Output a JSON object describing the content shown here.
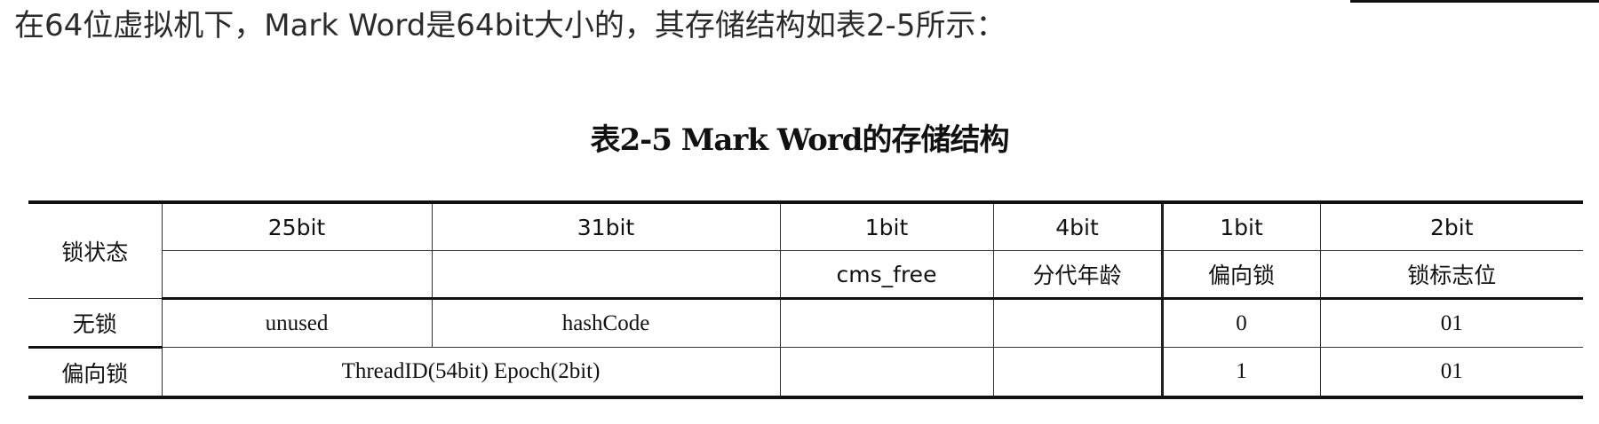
{
  "intro_text": "在64位虚拟机下，Mark Word是64bit大小的，其存储结构如表2-5所示：",
  "table_caption": "表2-5   Mark Word的存储结构",
  "table": {
    "lock_state_header": "锁状态",
    "bit_headers": [
      "25bit",
      "31bit",
      "1bit",
      "4bit",
      "1bit",
      "2bit"
    ],
    "field_headers": [
      "",
      "",
      "cms_free",
      "分代年龄",
      "偏向锁",
      "锁标志位"
    ],
    "rows": [
      {
        "state": "无锁",
        "unused": "unused",
        "hashcode": "hashCode",
        "cms_free": "",
        "age": "",
        "biased": "0",
        "flag": "01"
      },
      {
        "state": "偏向锁",
        "thread_epoch": "ThreadID(54bit) Epoch(2bit)",
        "cms_free": "",
        "age": "",
        "biased": "1",
        "flag": "01"
      }
    ]
  }
}
